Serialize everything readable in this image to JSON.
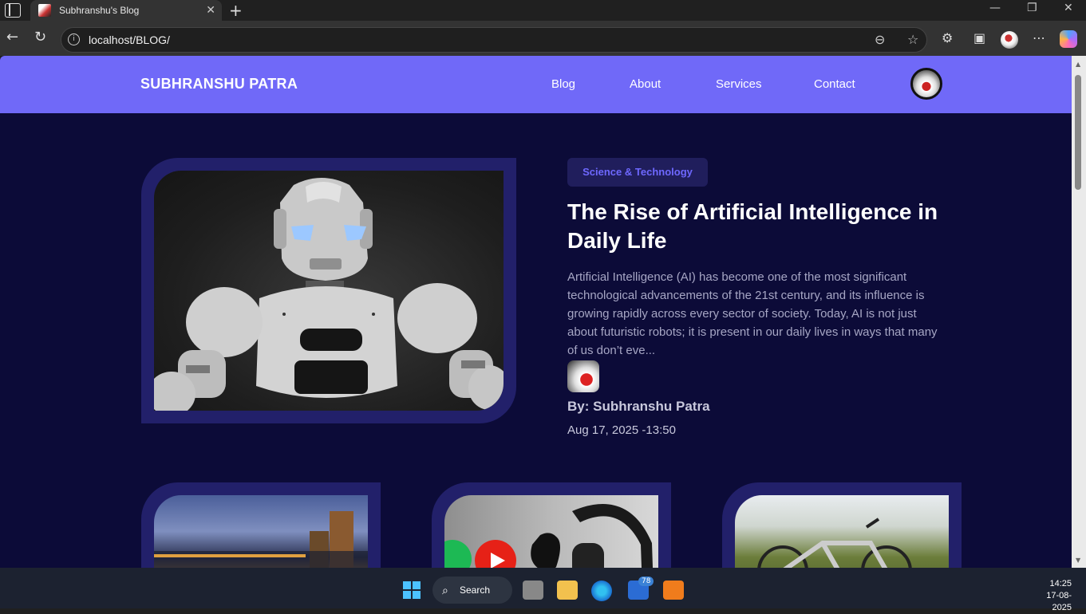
{
  "browser": {
    "tab_title": "Subhranshu's Blog",
    "url": "localhost/BLOG/"
  },
  "site": {
    "logo": "SUBHRANSHU PATRA",
    "nav": [
      "Blog",
      "About",
      "Services",
      "Contact"
    ]
  },
  "featured_post": {
    "category": "Science & Technology",
    "title": "The Rise of Artificial Intelligence in Daily Life",
    "excerpt": "Artificial Intelligence (AI) has become one of the most significant technological advancements of the 21st century, and its influence is growing rapidly across every sector of society. Today, AI is not just about futuristic robots; it is present in our daily lives in ways that many of us don’t eve...",
    "author": "By: Subhranshu Patra",
    "date": "Aug 17, 2025 -13:50"
  },
  "taskbar": {
    "search_label": "Search",
    "mail_badge": "78",
    "time": "14:25",
    "date": "17-08-2025"
  },
  "colors": {
    "header": "#7069f8",
    "page_bg": "#0c0b38",
    "frame": "#22206a",
    "accent": "#6e68ff"
  }
}
